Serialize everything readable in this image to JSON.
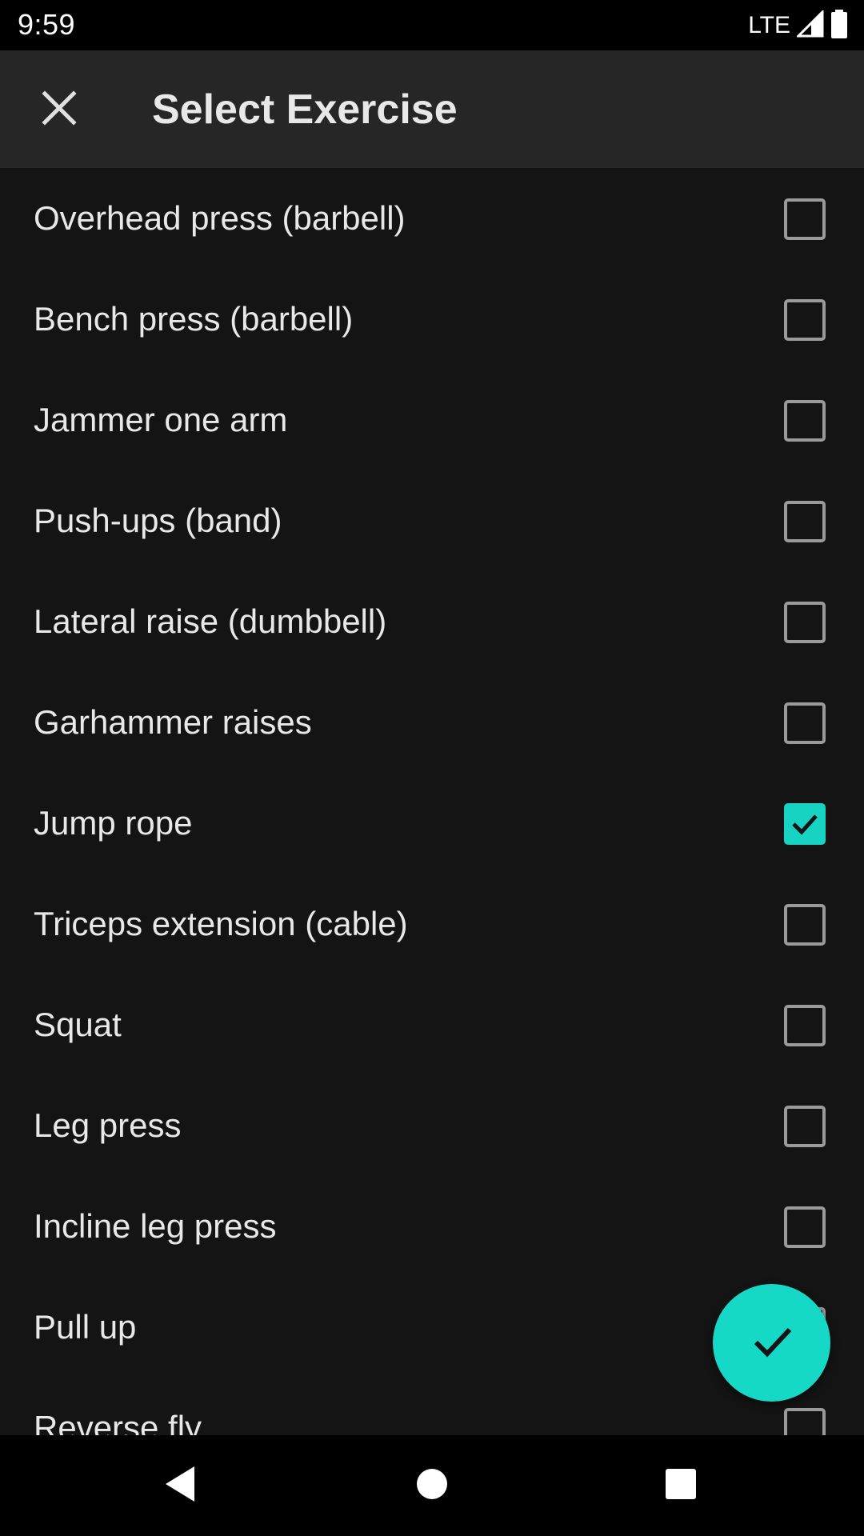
{
  "status_bar": {
    "time": "9:59",
    "network": "LTE"
  },
  "app_bar": {
    "title": "Select Exercise",
    "close_icon": "close-icon"
  },
  "colors": {
    "accent": "#16d4c1",
    "background": "#141414",
    "app_bar": "#262626"
  },
  "exercises": [
    {
      "label": "Overhead press (barbell)",
      "checked": false
    },
    {
      "label": "Bench press (barbell)",
      "checked": false
    },
    {
      "label": "Jammer one arm",
      "checked": false
    },
    {
      "label": "Push-ups (band)",
      "checked": false
    },
    {
      "label": "Lateral raise (dumbbell)",
      "checked": false
    },
    {
      "label": "Garhammer raises",
      "checked": false
    },
    {
      "label": "Jump rope",
      "checked": true
    },
    {
      "label": "Triceps extension (cable)",
      "checked": false
    },
    {
      "label": "Squat",
      "checked": false
    },
    {
      "label": "Leg press",
      "checked": false
    },
    {
      "label": "Incline leg press",
      "checked": false
    },
    {
      "label": "Pull up",
      "checked": false
    },
    {
      "label": "Reverse fly",
      "checked": false
    }
  ],
  "fab": {
    "icon": "check-icon"
  },
  "nav_bar": {
    "back": "back-icon",
    "home": "home-icon",
    "recents": "recents-icon"
  }
}
